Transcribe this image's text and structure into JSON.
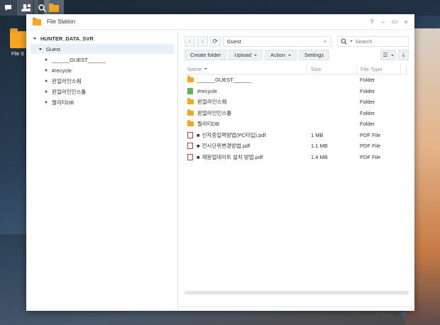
{
  "desktop": {
    "icon_label": "File S"
  },
  "window": {
    "title": "File Station",
    "help": "?",
    "minimize": "–",
    "maximize": "▭",
    "close": "×"
  },
  "tree": {
    "root": "HUNTER_DATA_SVR",
    "items": [
      {
        "label": "Guest",
        "level": 1,
        "expanded": true,
        "selected": true
      },
      {
        "label": "______GUEST______",
        "level": 2
      },
      {
        "label": "#recycle",
        "level": 2
      },
      {
        "label": "윈얼라인스퀘",
        "level": 2
      },
      {
        "label": "윈얼라인인스톨",
        "level": 2
      },
      {
        "label": "퀄리티DB",
        "level": 2
      }
    ]
  },
  "nav": {
    "path": "Guest",
    "search_placeholder": "Search"
  },
  "toolbar": {
    "create_folder": "Create folder",
    "upload": "Upload",
    "action": "Action",
    "settings": "Settings"
  },
  "columns": {
    "name": "Name",
    "size": "Size",
    "type": "File Type"
  },
  "files": [
    {
      "name": "______GUEST______",
      "size": "",
      "type": "Folder",
      "icon": "folder"
    },
    {
      "name": "#recycle",
      "size": "",
      "type": "Folder",
      "icon": "recycle"
    },
    {
      "name": "윈얼라인스퀘",
      "size": "",
      "type": "Folder",
      "icon": "folder"
    },
    {
      "name": "윈얼라인인스톨",
      "size": "",
      "type": "Folder",
      "icon": "folder"
    },
    {
      "name": "퀄리티DB",
      "size": "",
      "type": "Folder",
      "icon": "folder"
    },
    {
      "name": "신자증입력방법(PC타입).pdf",
      "size": "1 MB",
      "type": "PDF File",
      "icon": "pdf"
    },
    {
      "name": "전시단위변경방법.pdf",
      "size": "1.1 MB",
      "type": "PDF File",
      "icon": "pdf"
    },
    {
      "name": "재원업데이트 설치 방법.pdf",
      "size": "1.4 MB",
      "type": "PDF File",
      "icon": "pdf"
    }
  ],
  "status": {
    "count": "8 items"
  }
}
